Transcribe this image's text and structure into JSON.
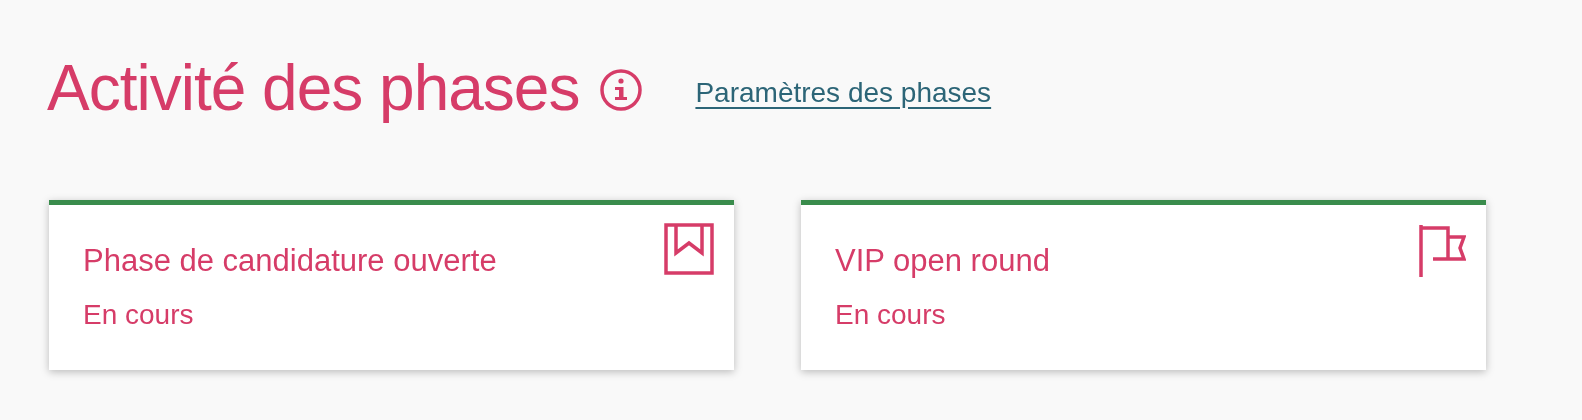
{
  "header": {
    "title": "Activité des phases",
    "link": "Paramètres des phases"
  },
  "phases": [
    {
      "title": "Phase de candidature ouverte",
      "status": "En cours",
      "kind": "bookmark"
    },
    {
      "title": "VIP open round",
      "status": "En cours",
      "kind": "flag"
    }
  ]
}
